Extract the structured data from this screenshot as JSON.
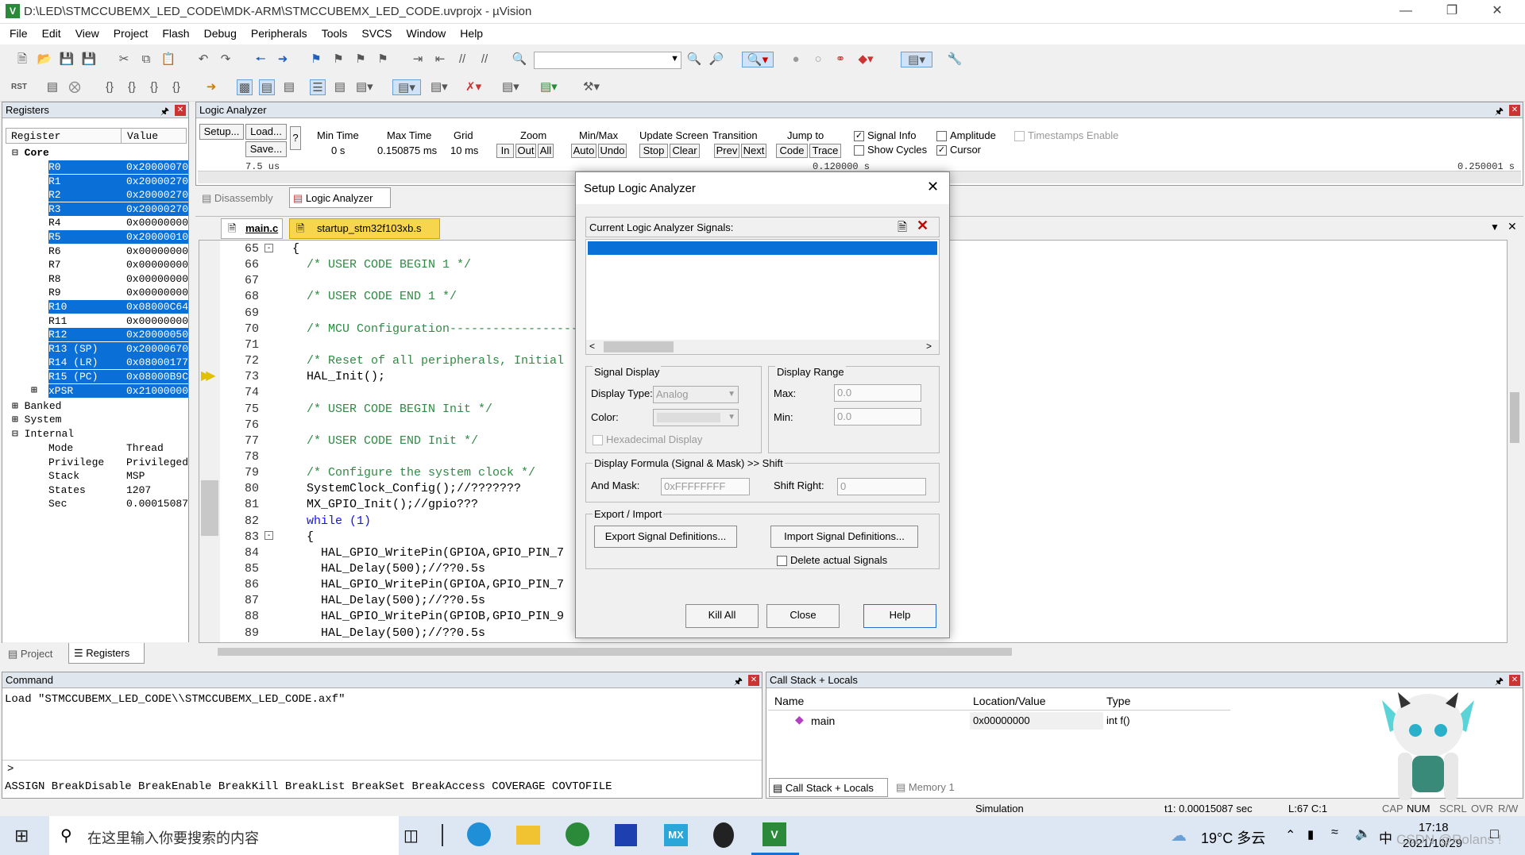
{
  "window": {
    "title": "D:\\LED\\STMCCUBEMX_LED_CODE\\MDK-ARM\\STMCCUBEMX_LED_CODE.uvprojx - µVision"
  },
  "menu": [
    "File",
    "Edit",
    "View",
    "Project",
    "Flash",
    "Debug",
    "Peripherals",
    "Tools",
    "SVCS",
    "Window",
    "Help"
  ],
  "registers": {
    "title": "Registers",
    "col_register": "Register",
    "col_value": "Value",
    "core_label": "Core",
    "rows": [
      {
        "n": "R0",
        "v": "0x20000070",
        "sel": true
      },
      {
        "n": "R1",
        "v": "0x20000270",
        "sel": true
      },
      {
        "n": "R2",
        "v": "0x20000270",
        "sel": true
      },
      {
        "n": "R3",
        "v": "0x20000270",
        "sel": true
      },
      {
        "n": "R4",
        "v": "0x00000000",
        "sel": false
      },
      {
        "n": "R5",
        "v": "0x20000010",
        "sel": true
      },
      {
        "n": "R6",
        "v": "0x00000000",
        "sel": false
      },
      {
        "n": "R7",
        "v": "0x00000000",
        "sel": false
      },
      {
        "n": "R8",
        "v": "0x00000000",
        "sel": false
      },
      {
        "n": "R9",
        "v": "0x00000000",
        "sel": false
      },
      {
        "n": "R10",
        "v": "0x08000C64",
        "sel": true
      },
      {
        "n": "R11",
        "v": "0x00000000",
        "sel": false
      },
      {
        "n": "R12",
        "v": "0x20000050",
        "sel": true
      },
      {
        "n": "R13 (SP)",
        "v": "0x20000670",
        "sel": true
      },
      {
        "n": "R14 (LR)",
        "v": "0x08000177",
        "sel": true
      },
      {
        "n": "R15 (PC)",
        "v": "0x08000B9C",
        "sel": true
      },
      {
        "n": "xPSR",
        "v": "0x21000000",
        "sel": true
      }
    ],
    "banked": "Banked",
    "system": "System",
    "internal": "Internal",
    "internal_rows": [
      {
        "n": "Mode",
        "v": "Thread"
      },
      {
        "n": "Privilege",
        "v": "Privileged"
      },
      {
        "n": "Stack",
        "v": "MSP"
      },
      {
        "n": "States",
        "v": "1207"
      },
      {
        "n": "Sec",
        "v": "0.00015087"
      }
    ],
    "tab_project": "Project",
    "tab_registers": "Registers"
  },
  "logic": {
    "title": "Logic Analyzer",
    "setup": "Setup...",
    "load": "Load...",
    "save": "Save...",
    "q": "?",
    "min_time_label": "Min Time",
    "min_time": "0 s",
    "max_time_label": "Max Time",
    "max_time": "0.150875 ms",
    "grid_label": "Grid",
    "grid": "10 ms",
    "zoom_label": "Zoom",
    "zoom_in": "In",
    "zoom_out": "Out",
    "zoom_all": "All",
    "minmax_label": "Min/Max",
    "auto": "Auto",
    "undo": "Undo",
    "update_label": "Update Screen",
    "stop": "Stop",
    "clear": "Clear",
    "transition_label": "Transition",
    "prev": "Prev",
    "next": "Next",
    "jump_label": "Jump to",
    "code": "Code",
    "trace": "Trace",
    "signal_info": "Signal Info",
    "show_cycles": "Show Cycles",
    "amplitude": "Amplitude",
    "cursor": "Cursor",
    "timestamps": "Timestamps Enable",
    "axis_left": "7.5 us",
    "axis_mid": "0.120000 s",
    "axis_right": "0.250001 s"
  },
  "tabs": {
    "disassembly": "Disassembly",
    "logic": "Logic Analyzer",
    "file1": "main.c",
    "file2": "startup_stm32f103xb.s"
  },
  "code": [
    {
      "n": "65",
      "t": "{",
      "c": ""
    },
    {
      "n": "66",
      "t": "  /* USER CODE BEGIN 1 */",
      "c": "cm"
    },
    {
      "n": "67",
      "t": "",
      "c": ""
    },
    {
      "n": "68",
      "t": "  /* USER CODE END 1 */",
      "c": "cm"
    },
    {
      "n": "69",
      "t": "",
      "c": ""
    },
    {
      "n": "70",
      "t": "  /* MCU Configuration---------------------",
      "c": "cm"
    },
    {
      "n": "71",
      "t": "",
      "c": ""
    },
    {
      "n": "72",
      "t": "  /* Reset of all peripherals, Initial",
      "c": "cm"
    },
    {
      "n": "73",
      "t": "  HAL_Init();",
      "c": ""
    },
    {
      "n": "74",
      "t": "",
      "c": ""
    },
    {
      "n": "75",
      "t": "  /* USER CODE BEGIN Init */",
      "c": "cm"
    },
    {
      "n": "76",
      "t": "",
      "c": ""
    },
    {
      "n": "77",
      "t": "  /* USER CODE END Init */",
      "c": "cm"
    },
    {
      "n": "78",
      "t": "",
      "c": ""
    },
    {
      "n": "79",
      "t": "  /* Configure the system clock */",
      "c": "cm"
    },
    {
      "n": "80",
      "t": "  SystemClock_Config();//???????",
      "c": ""
    },
    {
      "n": "81",
      "t": "  MX_GPIO_Init();//gpio???",
      "c": ""
    },
    {
      "n": "82",
      "t": "  while (1)",
      "c": "kw"
    },
    {
      "n": "83",
      "t": "  {",
      "c": ""
    },
    {
      "n": "84",
      "t": "    HAL_GPIO_WritePin(GPIOA,GPIO_PIN_7",
      "c": ""
    },
    {
      "n": "85",
      "t": "    HAL_Delay(500);//??0.5s",
      "c": ""
    },
    {
      "n": "86",
      "t": "    HAL_GPIO_WritePin(GPIOA,GPIO_PIN_7",
      "c": ""
    },
    {
      "n": "87",
      "t": "    HAL_Delay(500);//??0.5s",
      "c": ""
    },
    {
      "n": "88",
      "t": "    HAL_GPIO_WritePin(GPIOB,GPIO_PIN_9",
      "c": ""
    },
    {
      "n": "89",
      "t": "    HAL_Delay(500);//??0.5s",
      "c": ""
    }
  ],
  "dialog": {
    "title": "Setup Logic Analyzer",
    "signals_label": "Current Logic Analyzer Signals:",
    "signal_display": "Signal Display",
    "display_type_label": "Display Type:",
    "display_type": "Analog",
    "color_label": "Color:",
    "hex_display": "Hexadecimal Display",
    "display_range": "Display Range",
    "max_label": "Max:",
    "max": "0.0",
    "min_label": "Min:",
    "min": "0.0",
    "formula": "Display Formula (Signal & Mask) >> Shift",
    "and_mask_label": "And Mask:",
    "and_mask": "0xFFFFFFFF",
    "shift_label": "Shift Right:",
    "shift": "0",
    "export_import": "Export / Import",
    "export_btn": "Export Signal Definitions...",
    "import_btn": "Import Signal Definitions...",
    "delete_actual": "Delete actual Signals",
    "kill_all": "Kill All",
    "close": "Close",
    "help": "Help"
  },
  "command": {
    "title": "Command",
    "line": "Load \"STMCCUBEMX_LED_CODE\\\\STMCCUBEMX_LED_CODE.axf\"",
    "prompt": ">",
    "hints": "ASSIGN BreakDisable BreakEnable BreakKill BreakList BreakSet BreakAccess COVERAGE COVTOFILE"
  },
  "callstack": {
    "title": "Call Stack + Locals",
    "col_name": "Name",
    "col_loc": "Location/Value",
    "col_type": "Type",
    "row_name": "main",
    "row_loc": "0x00000000",
    "row_type": "int f()",
    "tab1": "Call Stack + Locals",
    "tab2": "Memory 1"
  },
  "status": {
    "mode": "Simulation",
    "time": "t1: 0.00015087 sec",
    "pos": "L:67 C:1",
    "cap": "CAP",
    "num": "NUM",
    "scrl": "SCRL",
    "ovr": "OVR",
    "rw": "R/W"
  },
  "taskbar": {
    "search": "在这里输入你要搜索的内容",
    "weather": "19°C 多云",
    "ime": "中",
    "time": "17:18",
    "date": "2021/10/29",
    "watermark": "CSDN @Rolans !"
  }
}
